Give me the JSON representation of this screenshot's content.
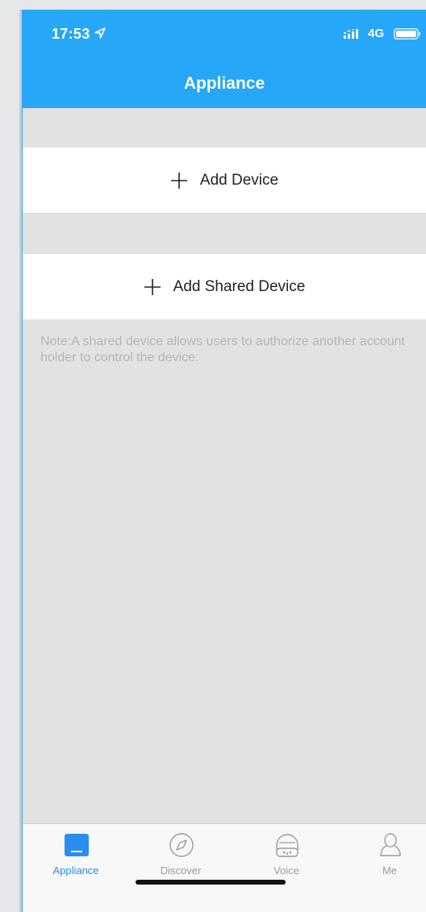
{
  "status": {
    "time": "17:53",
    "network": "4G"
  },
  "header": {
    "title": "Appliance"
  },
  "actions": {
    "add_device": "Add Device",
    "add_shared_device": "Add Shared Device"
  },
  "note": "Note:A shared device allows users to authorize another account holder to control the device.",
  "tabs": [
    {
      "label": "Appliance",
      "icon": "appliance-icon",
      "active": true
    },
    {
      "label": "Discover",
      "icon": "compass-icon",
      "active": false
    },
    {
      "label": "Voice",
      "icon": "voice-icon",
      "active": false
    },
    {
      "label": "Me",
      "icon": "person-icon",
      "active": false
    }
  ],
  "colors": {
    "header": "#26a7f7",
    "background": "#e2e2e2",
    "active_tab": "#2a8ef0",
    "inactive_tab": "#9b9b9b",
    "note_text": "#b6b6b6"
  }
}
